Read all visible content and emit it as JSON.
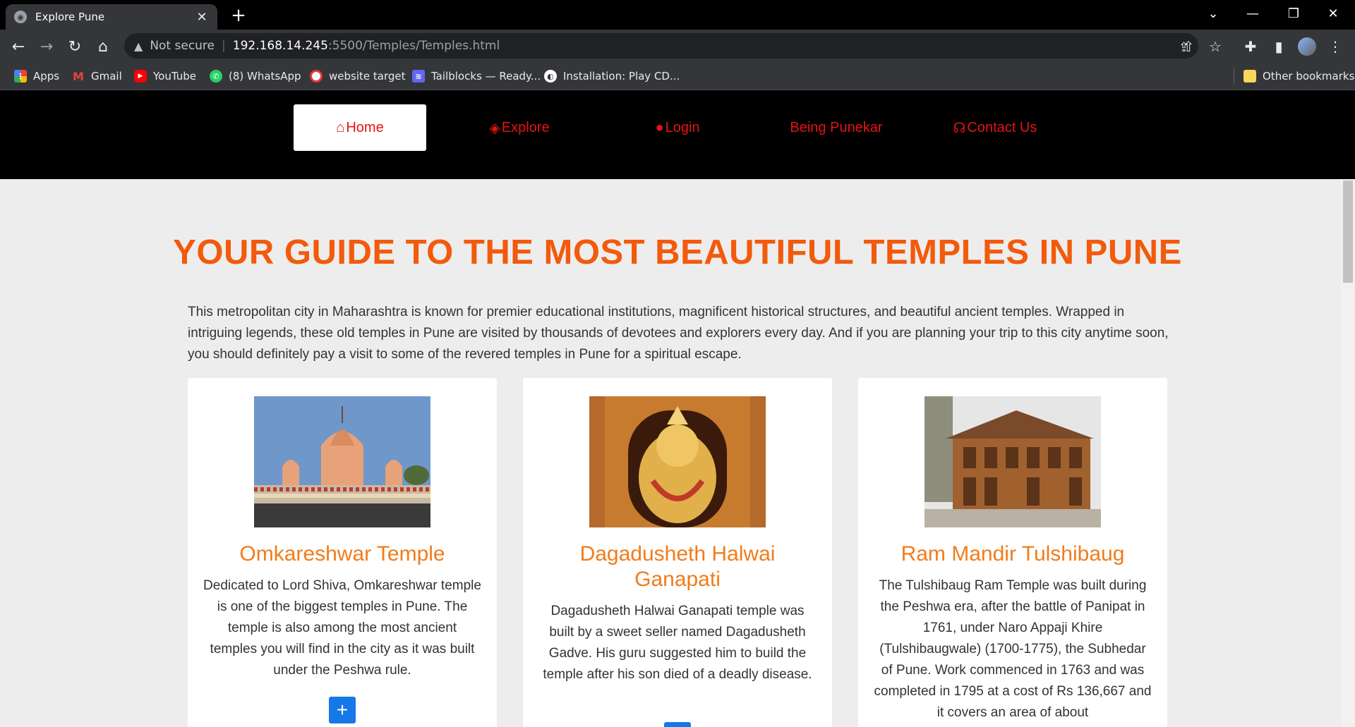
{
  "browser": {
    "tab_title": "Explore Pune",
    "url_warning": "Not secure",
    "url_host": "192.168.14.245",
    "url_path": ":5500/Temples/Temples.html",
    "bookmarks": [
      {
        "label": "Apps",
        "icon": "apps-grid-icon",
        "color": "#ea4335"
      },
      {
        "label": "Gmail",
        "icon": "gmail-icon",
        "color": "#ea4335"
      },
      {
        "label": "YouTube",
        "icon": "youtube-icon",
        "color": "#ff0000"
      },
      {
        "label": "(8) WhatsApp",
        "icon": "whatsapp-icon",
        "color": "#25d366"
      },
      {
        "label": "website target",
        "icon": "target-icon",
        "color": "#e53935"
      },
      {
        "label": "Tailblocks — Ready...",
        "icon": "tailblocks-icon",
        "color": "#6366f1"
      },
      {
        "label": "Installation: Play CD...",
        "icon": "globe-icon",
        "color": "#ffffff"
      }
    ],
    "other_bookmarks": "Other bookmarks"
  },
  "nav": {
    "items": [
      {
        "label": "Home",
        "icon": "home-icon"
      },
      {
        "label": "Explore",
        "icon": "diamond-direction-icon"
      },
      {
        "label": "Login",
        "icon": "user-icon"
      },
      {
        "label": "Being Punekar",
        "icon": ""
      },
      {
        "label": "Contact Us",
        "icon": "headset-icon"
      }
    ],
    "active_color": "#e31414"
  },
  "page": {
    "headline": "YOUR GUIDE TO THE MOST BEAUTIFUL TEMPLES IN PUNE",
    "intro": "This metropolitan city in Maharashtra is known for premier educational institutions, magnificent historical structures, and beautiful ancient temples. Wrapped in intriguing legends, these old temples in Pune are visited by thousands of devotees and explorers every day. And if you are planning your trip to this city anytime soon, you should definitely pay a visit to some of the revered temples in Pune for a spiritual escape.",
    "cards": [
      {
        "title": "Omkareshwar Temple",
        "text": "Dedicated to Lord Shiva, Omkareshwar temple is one of the biggest temples in Pune. The temple is also among the most ancient temples you will find in the city as it was built under the Peshwa rule.",
        "button": "+"
      },
      {
        "title": "Dagadusheth Halwai Ganapati",
        "text": "Dagadusheth Halwai Ganapati temple was built by a sweet seller named Dagadusheth Gadve. His guru suggested him to build the temple after his son died of a deadly disease.",
        "button": "+"
      },
      {
        "title": "Ram Mandir Tulshibaug",
        "text": "The Tulshibaug Ram Temple was built during the Peshwa era, after the battle of Panipat in 1761, under Naro Appaji Khire (Tulshibaugwale) (1700-1775), the Subhedar of Pune. Work commenced in 1763 and was completed in 1795 at a cost of Rs 136,667 and it covers an area of about",
        "button": "+"
      }
    ]
  }
}
